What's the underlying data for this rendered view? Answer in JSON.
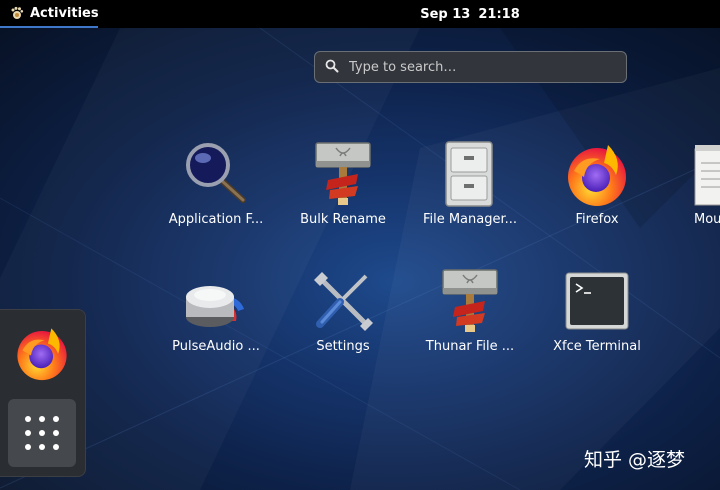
{
  "topbar": {
    "activities_label": "Activities",
    "date": "Sep 13",
    "time": "21:18"
  },
  "search": {
    "placeholder": "Type to search…"
  },
  "apps": [
    {
      "label": "Application F...",
      "icon": "magnifier-icon"
    },
    {
      "label": "Bulk Rename",
      "icon": "bulk-rename-icon"
    },
    {
      "label": "File Manager...",
      "icon": "file-cabinet-icon"
    },
    {
      "label": "Firefox",
      "icon": "firefox-icon"
    },
    {
      "label": "Mou",
      "icon": "notepad-icon"
    },
    {
      "label": "PulseAudio ...",
      "icon": "pulseaudio-icon"
    },
    {
      "label": "Settings",
      "icon": "settings-tools-icon"
    },
    {
      "label": "Thunar File ...",
      "icon": "thunar-icon"
    },
    {
      "label": "Xfce Terminal",
      "icon": "terminal-icon"
    }
  ],
  "dash": {
    "favorite": "Firefox",
    "show_apps_icon": "app-grid-icon"
  },
  "watermark": "知乎 @逐梦"
}
